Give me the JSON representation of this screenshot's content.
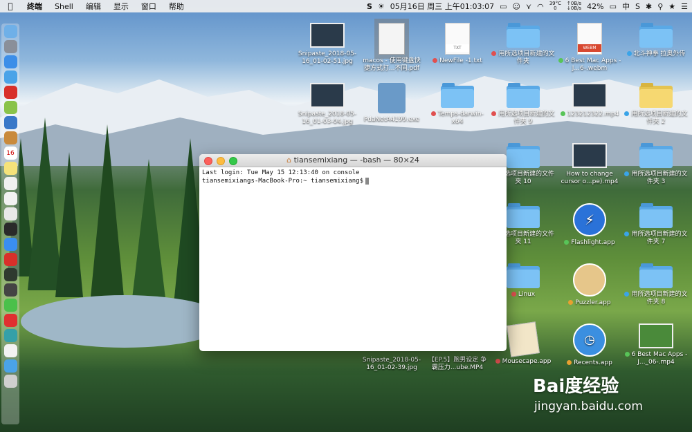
{
  "menubar": {
    "app": "终端",
    "menus": [
      "Shell",
      "编辑",
      "显示",
      "窗口",
      "帮助"
    ],
    "status": {
      "temp": "39°C",
      "temp_sub": "0",
      "net_up": "0B/s",
      "net_down": "0B/s",
      "battery": "42%",
      "datetime": "05月16日 周三 上午01:03:07",
      "input": "中"
    }
  },
  "dock": {
    "items": [
      "finder-icon",
      "launchpad-icon",
      "safari-icon",
      "qq-icon",
      "netease-music-icon",
      "android-icon",
      "preview-icon",
      "book-icon",
      "calendar-icon",
      "notes-icon",
      "photos-icon",
      "textedit-icon",
      "chrome-icon",
      "terminal-icon",
      "appstore-icon",
      "vivaldi-icon",
      "terminal2-icon",
      "console-icon",
      "wechat-icon",
      "weibo-icon",
      "other-app-icon",
      "document-icon",
      "downloads-folder-icon",
      "trash-icon"
    ],
    "calendar_day": "16"
  },
  "desktop": {
    "icons": [
      {
        "label": "Snipaste_2018-05-16_01-02-51.jpg",
        "kind": "image"
      },
      {
        "label": "macos - 使用键盘快捷方式打...不同.pdf",
        "kind": "pdf"
      },
      {
        "label": "NewFile -1.txt",
        "kind": "txt",
        "tag": "#e05050",
        "badge": "TXT"
      },
      {
        "label": "用所选项目新建的文件夹",
        "kind": "folder",
        "tag": "#e05050"
      },
      {
        "label": "6 Best Mac Apps - J...6-.webm",
        "kind": "webm",
        "tag": "#58c458",
        "badge": "WEBM"
      },
      {
        "label": "北斗神拳 拉奥外传",
        "kind": "folder",
        "tag": "#3aa4e8"
      },
      {
        "label": "Snipaste_2018-05-16_01-03-04.jpg",
        "kind": "image"
      },
      {
        "label": "PdaNetA4199.exe",
        "kind": "exe"
      },
      {
        "label": "Temps-darwin-x64",
        "kind": "folder",
        "tag": "#e05050"
      },
      {
        "label": "用所选项目新建的文件夹 9",
        "kind": "folder",
        "tag": "#e05050"
      },
      {
        "label": "123212322.mp4",
        "kind": "video",
        "tag": "#58c458"
      },
      {
        "label": "用所选项目新建的文件夹 2",
        "kind": "folder-yellow",
        "tag": "#3aa4e8"
      },
      {
        "label": "用所选项目新建的文件夹 10",
        "kind": "folder"
      },
      {
        "label": "How to change cursor o...pe).mp4",
        "kind": "video"
      },
      {
        "label": "用所选项目新建的文件夹 3",
        "kind": "folder",
        "tag": "#3aa4e8"
      },
      {
        "label": "用所选项目新建的文件夹 11",
        "kind": "folder"
      },
      {
        "label": "Flashlight.app",
        "kind": "flashlight",
        "tag": "#58c458"
      },
      {
        "label": "用所选项目新建的文件夹 7",
        "kind": "folder",
        "tag": "#3aa4e8"
      },
      {
        "label": "Linux",
        "kind": "folder",
        "tag": "#e05050"
      },
      {
        "label": "Puzzler.app",
        "kind": "puzzler",
        "tag": "#e8a030"
      },
      {
        "label": "用所选项目新建的文件夹 8",
        "kind": "folder",
        "tag": "#3aa4e8"
      },
      {
        "label": "Snipaste_2018-05-16_01-02-39.jpg",
        "kind": "hidden"
      },
      {
        "label": "【EP.5】跑男设定 争霸压力...ube.MP4",
        "kind": "hidden"
      },
      {
        "label": "Mousecape.app",
        "kind": "mousecape",
        "tag": "#e05050"
      },
      {
        "label": "Recents.app",
        "kind": "recents",
        "tag": "#e8a030"
      },
      {
        "label": "6 Best Mac Apps - J..._06-.mp4",
        "kind": "video-green",
        "tag": "#58c458"
      }
    ]
  },
  "terminal": {
    "title": "tiansemixiang — -bash — 80×24",
    "lines": [
      "Last login: Tue May 15 12:13:40 on console",
      "tiansemixiangs-MacBook-Pro:~ tiansemixiang$"
    ]
  },
  "watermark": {
    "brand": "Bai度经验",
    "url": "jingyan.baidu.com"
  },
  "colors": {
    "folder_blue": "#7cc2f5",
    "tag_red": "#e05050",
    "tag_green": "#58c458",
    "tag_blue": "#3aa4e8",
    "tag_orange": "#e8a030"
  }
}
